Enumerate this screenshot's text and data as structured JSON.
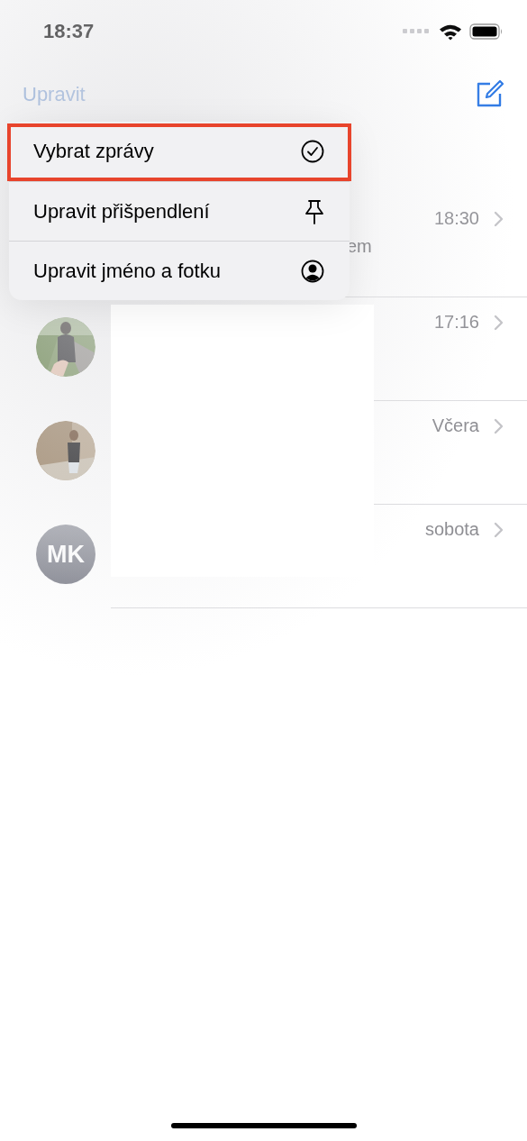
{
  "status_bar": {
    "time": "18:37"
  },
  "nav": {
    "edit_label": "Upravit"
  },
  "conversations": [
    {
      "time": "18:30",
      "preview": "em"
    },
    {
      "time": "17:16"
    },
    {
      "time": "Včera"
    },
    {
      "time": "sobota",
      "avatar": {
        "kind": "initials",
        "initials": "MK"
      }
    }
  ],
  "menu": {
    "items": [
      {
        "label": "Vybrat zprávy",
        "kind": "check",
        "highlighted": true
      },
      {
        "label": "Upravit přišpendlení",
        "kind": "pin",
        "highlighted": false
      },
      {
        "label": "Upravit jméno a fotku",
        "kind": "person",
        "highlighted": false
      }
    ]
  }
}
